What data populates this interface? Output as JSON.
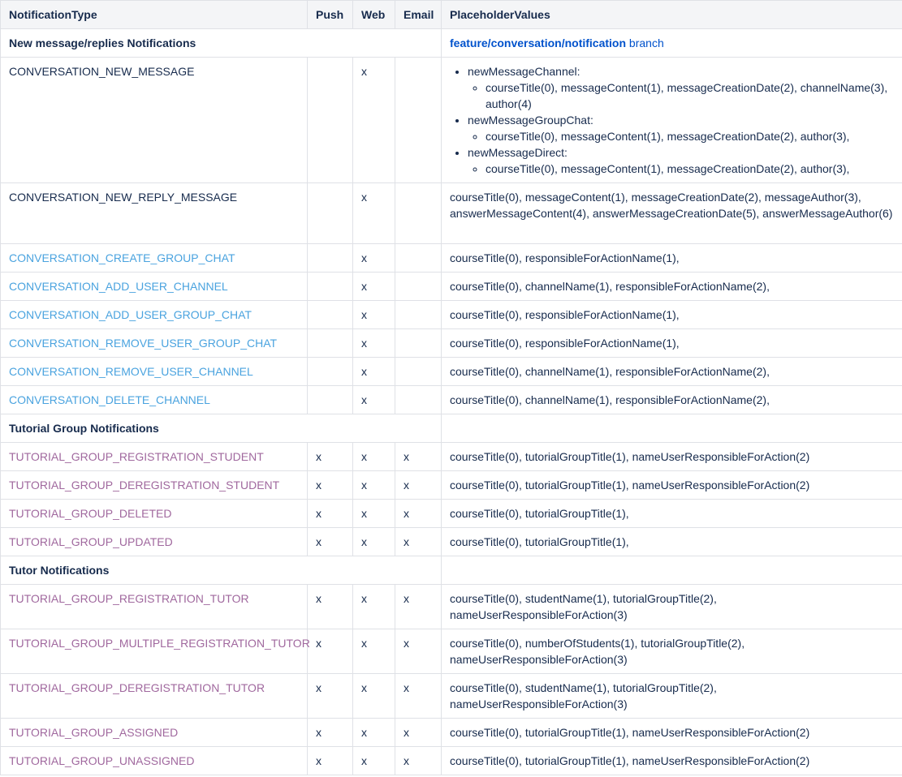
{
  "headers": {
    "type": "NotificationType",
    "push": "Push",
    "web": "Web",
    "email": "Email",
    "placeholders": "PlaceholderValues"
  },
  "sections": {
    "new_message": {
      "title": "New message/replies Notifications",
      "branch_link": "feature/conversation/notification",
      "branch_suffix": " branch"
    },
    "tutorial_group": {
      "title": "Tutorial Group Notifications"
    },
    "tutor": {
      "title": "Tutor Notifications"
    }
  },
  "rows": {
    "conv_new_message": {
      "type": "CONVERSATION_NEW_MESSAGE",
      "push": "",
      "web": "x",
      "email": "",
      "list": [
        {
          "label": "newMessageChannel:",
          "sub": "courseTitle(0), messageContent(1), messageCreationDate(2), channelName(3), author(4)"
        },
        {
          "label": "newMessageGroupChat:",
          "sub": "courseTitle(0), messageContent(1), messageCreationDate(2), author(3),"
        },
        {
          "label": "newMessageDirect:",
          "sub": "courseTitle(0), messageContent(1), messageCreationDate(2), author(3),"
        }
      ]
    },
    "conv_new_reply": {
      "type": "CONVERSATION_NEW_REPLY_MESSAGE",
      "push": "",
      "web": "x",
      "email": "",
      "placeholders": "courseTitle(0), messageContent(1), messageCreationDate(2), messageAuthor(3), answerMessageContent(4), answerMessageCreationDate(5), answerMessageAuthor(6)"
    },
    "conv_create_group_chat": {
      "type": "CONVERSATION_CREATE_GROUP_CHAT",
      "push": "",
      "web": "x",
      "email": "",
      "placeholders": "courseTitle(0), responsibleForActionName(1),"
    },
    "conv_add_user_channel": {
      "type": "CONVERSATION_ADD_USER_CHANNEL",
      "push": "",
      "web": "x",
      "email": "",
      "placeholders": "courseTitle(0), channelName(1), responsibleForActionName(2),"
    },
    "conv_add_user_group_chat": {
      "type": "CONVERSATION_ADD_USER_GROUP_CHAT",
      "push": "",
      "web": "x",
      "email": "",
      "placeholders": "courseTitle(0), responsibleForActionName(1),"
    },
    "conv_remove_user_group_chat": {
      "type": "CONVERSATION_REMOVE_USER_GROUP_CHAT",
      "push": "",
      "web": "x",
      "email": "",
      "placeholders": "courseTitle(0), responsibleForActionName(1),"
    },
    "conv_remove_user_channel": {
      "type": "CONVERSATION_REMOVE_USER_CHANNEL",
      "push": "",
      "web": "x",
      "email": "",
      "placeholders": "courseTitle(0), channelName(1), responsibleForActionName(2),"
    },
    "conv_delete_channel": {
      "type": "CONVERSATION_DELETE_CHANNEL",
      "push": "",
      "web": "x",
      "email": "",
      "placeholders": "courseTitle(0), channelName(1), responsibleForActionName(2),"
    },
    "tg_registration_student": {
      "type": "TUTORIAL_GROUP_REGISTRATION_STUDENT",
      "push": "x",
      "web": "x",
      "email": "x",
      "placeholders": "courseTitle(0), tutorialGroupTitle(1), nameUserResponsibleForAction(2)"
    },
    "tg_deregistration_student": {
      "type": "TUTORIAL_GROUP_DEREGISTRATION_STUDENT",
      "push": "x",
      "web": "x",
      "email": "x",
      "placeholders": "courseTitle(0), tutorialGroupTitle(1), nameUserResponsibleForAction(2)"
    },
    "tg_deleted": {
      "type": "TUTORIAL_GROUP_DELETED",
      "push": "x",
      "web": "x",
      "email": "x",
      "placeholders": "courseTitle(0), tutorialGroupTitle(1),"
    },
    "tg_updated": {
      "type": "TUTORIAL_GROUP_UPDATED",
      "push": "x",
      "web": "x",
      "email": "x",
      "placeholders": "courseTitle(0), tutorialGroupTitle(1),"
    },
    "tg_registration_tutor": {
      "type": "TUTORIAL_GROUP_REGISTRATION_TUTOR",
      "push": "x",
      "web": "x",
      "email": "x",
      "placeholders": "courseTitle(0), studentName(1), tutorialGroupTitle(2), nameUserResponsibleForAction(3)"
    },
    "tg_multiple_registration_tutor": {
      "type": "TUTORIAL_GROUP_MULTIPLE_REGISTRATION_TUTOR",
      "push": "x",
      "web": "x",
      "email": "x",
      "placeholders": "courseTitle(0), numberOfStudents(1), tutorialGroupTitle(2), nameUserResponsibleForAction(3)"
    },
    "tg_deregistration_tutor": {
      "type": "TUTORIAL_GROUP_DEREGISTRATION_TUTOR",
      "push": "x",
      "web": "x",
      "email": "x",
      "placeholders": "courseTitle(0), studentName(1), tutorialGroupTitle(2), nameUserResponsibleForAction(3)"
    },
    "tg_assigned": {
      "type": "TUTORIAL_GROUP_ASSIGNED",
      "push": "x",
      "web": "x",
      "email": "x",
      "placeholders": "courseTitle(0), tutorialGroupTitle(1), nameUserResponsibleForAction(2)"
    },
    "tg_unassigned": {
      "type": "TUTORIAL_GROUP_UNASSIGNED",
      "push": "x",
      "web": "x",
      "email": "x",
      "placeholders": "courseTitle(0), tutorialGroupTitle(1), nameUserResponsibleForAction(2)"
    }
  },
  "colors": {
    "header_bg": "#f4f5f7",
    "border": "#dfe1e6",
    "text": "#172b4d",
    "link": "#0052cc",
    "conversation_type": "#4aa3df",
    "tutorial_type": "#a0689e"
  }
}
